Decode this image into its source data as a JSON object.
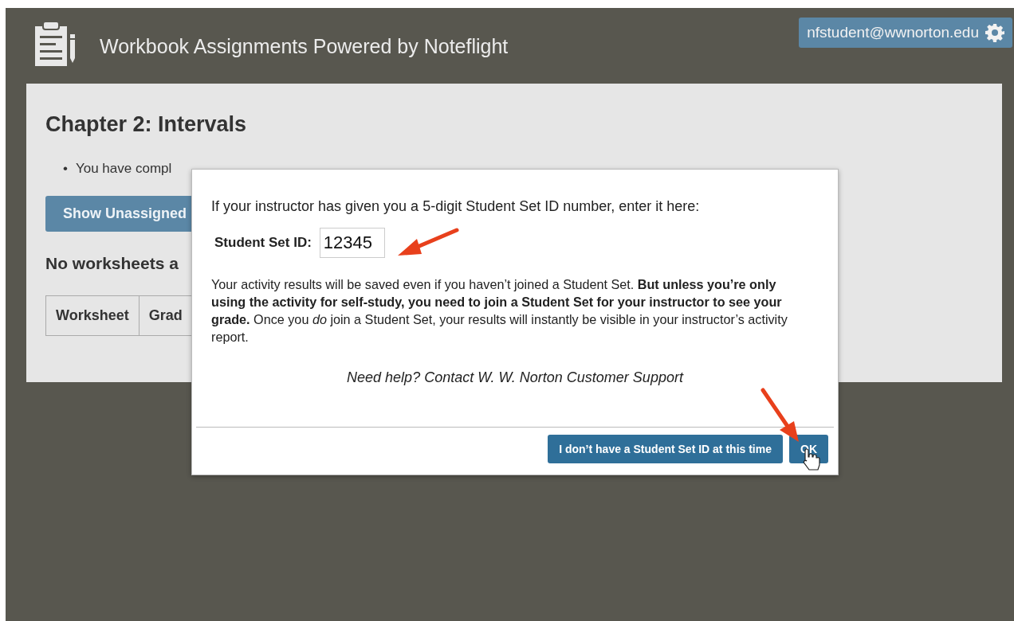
{
  "header": {
    "title": "Workbook Assignments Powered by Noteflight",
    "user_button": "nfstudent@wwnorton.edu"
  },
  "page": {
    "heading": "Chapter 2: Intervals",
    "bullets": [
      {
        "marker": "•",
        "text": "You have compl"
      }
    ],
    "show_button": "Show Unassigned",
    "subheading": "No worksheets a",
    "table": {
      "columns": [
        "Worksheet",
        "Grad"
      ]
    }
  },
  "dialog": {
    "prompt": "If your instructor has given you a 5-digit Student Set ID number, enter it here:",
    "field": {
      "label": "Student Set ID:",
      "value": "12345"
    },
    "note": "Your activity results will be saved even if you haven’t joined a Student Set. **But unless you’re only using the activity for self-study, you need to join a Student Set for your instructor to see your grade.** Once you *do* join a Student Set, your results will instantly be visible in your instructor’s activity report.",
    "help": "Need help? Contact W. W. Norton Customer Support",
    "buttons": [
      "I don’t have a Student Set ID at this time",
      "OK"
    ]
  }
}
